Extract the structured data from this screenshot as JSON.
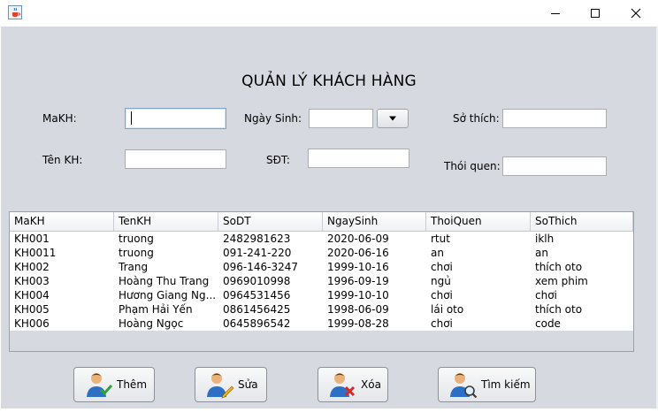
{
  "window": {
    "title": ""
  },
  "form_title": "QUẢN LÝ KHÁCH HÀNG",
  "fields": {
    "makh": {
      "label": "MaKH:",
      "value": ""
    },
    "tenkh": {
      "label": "Tên KH:",
      "value": ""
    },
    "ngaysinh": {
      "label": "Ngày Sinh:",
      "value": ""
    },
    "sdt": {
      "label": "SĐT:",
      "value": ""
    },
    "sothich": {
      "label": "Sở thích:",
      "value": ""
    },
    "thoiquen": {
      "label": "Thói quen:",
      "value": ""
    }
  },
  "table": {
    "columns": [
      "MaKH",
      "TenKH",
      "SoDT",
      "NgaySinh",
      "ThoiQuen",
      "SoThich"
    ],
    "rows": [
      [
        "KH001",
        "truong",
        "2482981623",
        "2020-06-09",
        "rtut",
        "iklh"
      ],
      [
        "KH0011",
        "truong",
        "091-241-220",
        "2020-06-16",
        "an",
        "an"
      ],
      [
        "KH002",
        "Trang",
        "096-146-3247",
        "1999-10-16",
        "chơi",
        "thích oto"
      ],
      [
        "KH003",
        "Hoàng Thu Trang",
        "0969010998",
        "1996-09-19",
        "ngủ",
        "xem phim"
      ],
      [
        "KH004",
        "Hương Giang Ng...",
        "0964531456",
        "1999-10-10",
        "chơi",
        "chơi"
      ],
      [
        "KH005",
        "Phạm Hải Yến",
        "0861456425",
        "1998-06-09",
        "lái oto",
        "thích oto"
      ],
      [
        "KH006",
        "Hoàng Ngọc",
        "0645896542",
        "1999-08-28",
        "chơi",
        "code"
      ]
    ]
  },
  "buttons": {
    "them": "Thêm",
    "sua": "Sửa",
    "xoa": "Xóa",
    "timkiem": "Tìm kiếm"
  },
  "icons": {
    "app": "java-cup-icon",
    "minimize": "minimize-icon",
    "maximize": "maximize-icon",
    "close": "close-icon",
    "date": "dropdown-arrow-icon",
    "them": "user-add-icon",
    "sua": "user-edit-icon",
    "xoa": "user-delete-icon",
    "timkiem": "user-search-icon"
  }
}
